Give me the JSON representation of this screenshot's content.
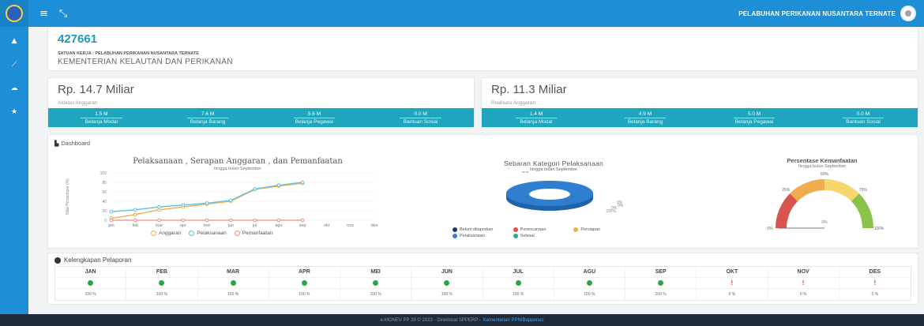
{
  "topbar": {
    "menu_icon": "≡",
    "expand_icon": "⤡",
    "title": "PELABUHAN PERIKANAN NUSANTARA TERNATE"
  },
  "sidebar": {
    "items": [
      {
        "icon": "home-icon",
        "glyph": "▲"
      },
      {
        "icon": "edit-icon",
        "glyph": "⟋"
      },
      {
        "icon": "cloud-icon",
        "glyph": "☁"
      },
      {
        "icon": "star-icon",
        "glyph": "★"
      }
    ]
  },
  "header": {
    "code": "427661",
    "satuan": "SATUAN KERJA : PELABUHAN PERIKANAN NUSANTARA TERNATE",
    "kementerian": "KEMENTERIAN KELAUTAN DAN PERIKANAN"
  },
  "budget_left": {
    "amount": "Rp. 14.7 Miliar",
    "label": "Alokasi Anggaran",
    "items": [
      {
        "value": "1.5 M",
        "caption": "Belanja Modal"
      },
      {
        "value": "7.6 M",
        "caption": "Belanja Barang"
      },
      {
        "value": "5.6 M",
        "caption": "Belanja Pegawai"
      },
      {
        "value": "0.0 M",
        "caption": "Bantuan Sosial"
      }
    ]
  },
  "budget_right": {
    "amount": "Rp. 11.3 Miliar",
    "label": "Realisasi Anggaran",
    "items": [
      {
        "value": "1.4 M",
        "caption": "Belanja Modal"
      },
      {
        "value": "4.9 M",
        "caption": "Belanja Barang"
      },
      {
        "value": "5.0 M",
        "caption": "Belanja Pegawai"
      },
      {
        "value": "0.0 M",
        "caption": "Bantuan Sosial"
      }
    ]
  },
  "dashboard": {
    "title": "Dashboard"
  },
  "chart_data": [
    {
      "type": "line",
      "title": "Pelaksanaan , Serapan Anggaran , dan Pemanfaatan",
      "subtitle": "hingga bulan September",
      "ylabel": "Nilai Persentase (%)",
      "ylim": [
        0,
        100
      ],
      "yticks": [
        0,
        20,
        40,
        60,
        80,
        100
      ],
      "categories": [
        "jan",
        "feb",
        "mar",
        "apr",
        "mei",
        "jun",
        "jul",
        "agu",
        "sep",
        "okt",
        "nov",
        "des"
      ],
      "series": [
        {
          "name": "Anggaran",
          "color": "#f0ad4e",
          "values": [
            4,
            12,
            22,
            28,
            34,
            40,
            65,
            72,
            78,
            null,
            null,
            null
          ]
        },
        {
          "name": "Pelaksanaan",
          "color": "#5bc0de",
          "values": [
            18,
            22,
            28,
            32,
            36,
            42,
            66,
            74,
            80,
            null,
            null,
            null
          ]
        },
        {
          "name": "Pemanfaatan",
          "color": "#f28b82",
          "values": [
            0,
            0,
            0,
            0,
            0,
            0,
            0,
            0,
            0,
            null,
            null,
            null
          ]
        }
      ]
    },
    {
      "type": "pie",
      "title": "Sebaran Kategori Pelaksanaan",
      "subtitle": "hingga bulan September",
      "categories": [
        "Belum dilaporkan",
        "Perencanaan",
        "Persiapan",
        "Pelaksanaan",
        "Selesai"
      ],
      "colors": [
        "#1f3b5c",
        "#e84c3d",
        "#f0ad4e",
        "#2f7fd1",
        "#2ca58d"
      ],
      "values": [
        0,
        0,
        0,
        100,
        0
      ],
      "labels": [
        "100%",
        "0%",
        "0%",
        "0%",
        "0%"
      ]
    },
    {
      "type": "gauge",
      "title": "Persentase Kemanfaatan",
      "subtitle": "hingga bulan September",
      "value": 0,
      "labels": [
        "0%",
        "25%",
        "50%",
        "75%",
        "100%"
      ],
      "value_label": "0%",
      "band_colors": [
        "#d9534f",
        "#f0ad4e",
        "#f5d76e",
        "#8bc34a"
      ]
    }
  ],
  "kelengkapan": {
    "title": "Kelengkapan Pelaporan",
    "months": [
      {
        "m": "JAN",
        "ok": true,
        "pct": "100 %"
      },
      {
        "m": "FEB",
        "ok": true,
        "pct": "100 %"
      },
      {
        "m": "MAR",
        "ok": true,
        "pct": "100 %"
      },
      {
        "m": "APR",
        "ok": true,
        "pct": "100 %"
      },
      {
        "m": "MEI",
        "ok": true,
        "pct": "100 %"
      },
      {
        "m": "JUN",
        "ok": true,
        "pct": "100 %"
      },
      {
        "m": "JUL",
        "ok": true,
        "pct": "100 %"
      },
      {
        "m": "AGU",
        "ok": true,
        "pct": "100 %"
      },
      {
        "m": "SEP",
        "ok": true,
        "pct": "100 %"
      },
      {
        "m": "OKT",
        "ok": false,
        "pct": "0 %"
      },
      {
        "m": "NOV",
        "ok": false,
        "pct": "0 %"
      },
      {
        "m": "DES",
        "ok": false,
        "pct": "0 %"
      }
    ]
  },
  "footer": {
    "text": "e-MONEV PP 39 © 2023 - Direktorat SPPERP -",
    "link": "Kementerian PPN/Bappenas"
  }
}
